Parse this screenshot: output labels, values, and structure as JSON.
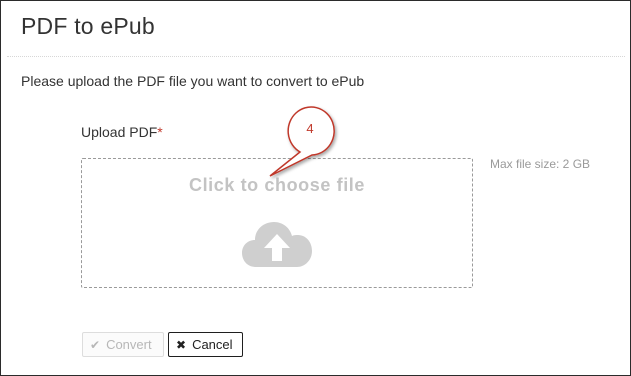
{
  "header": {
    "title": "PDF to ePub"
  },
  "main": {
    "instructions": "Please upload the PDF file you want to convert to ePub",
    "upload_label": "Upload PDF",
    "required_marker": "*",
    "dropzone_text": "Click to choose file",
    "max_size": "Max file size: 2 GB"
  },
  "buttons": {
    "convert_label": "Convert",
    "cancel_label": "Cancel"
  },
  "annotation": {
    "number": "4"
  },
  "colors": {
    "required": "#c0392b",
    "callout_border": "#c0392b",
    "cloud": "#cfcfcf"
  },
  "icons": {
    "dropzone": "cloud-upload-icon",
    "convert": "checkmark-icon",
    "cancel": "x-icon"
  }
}
